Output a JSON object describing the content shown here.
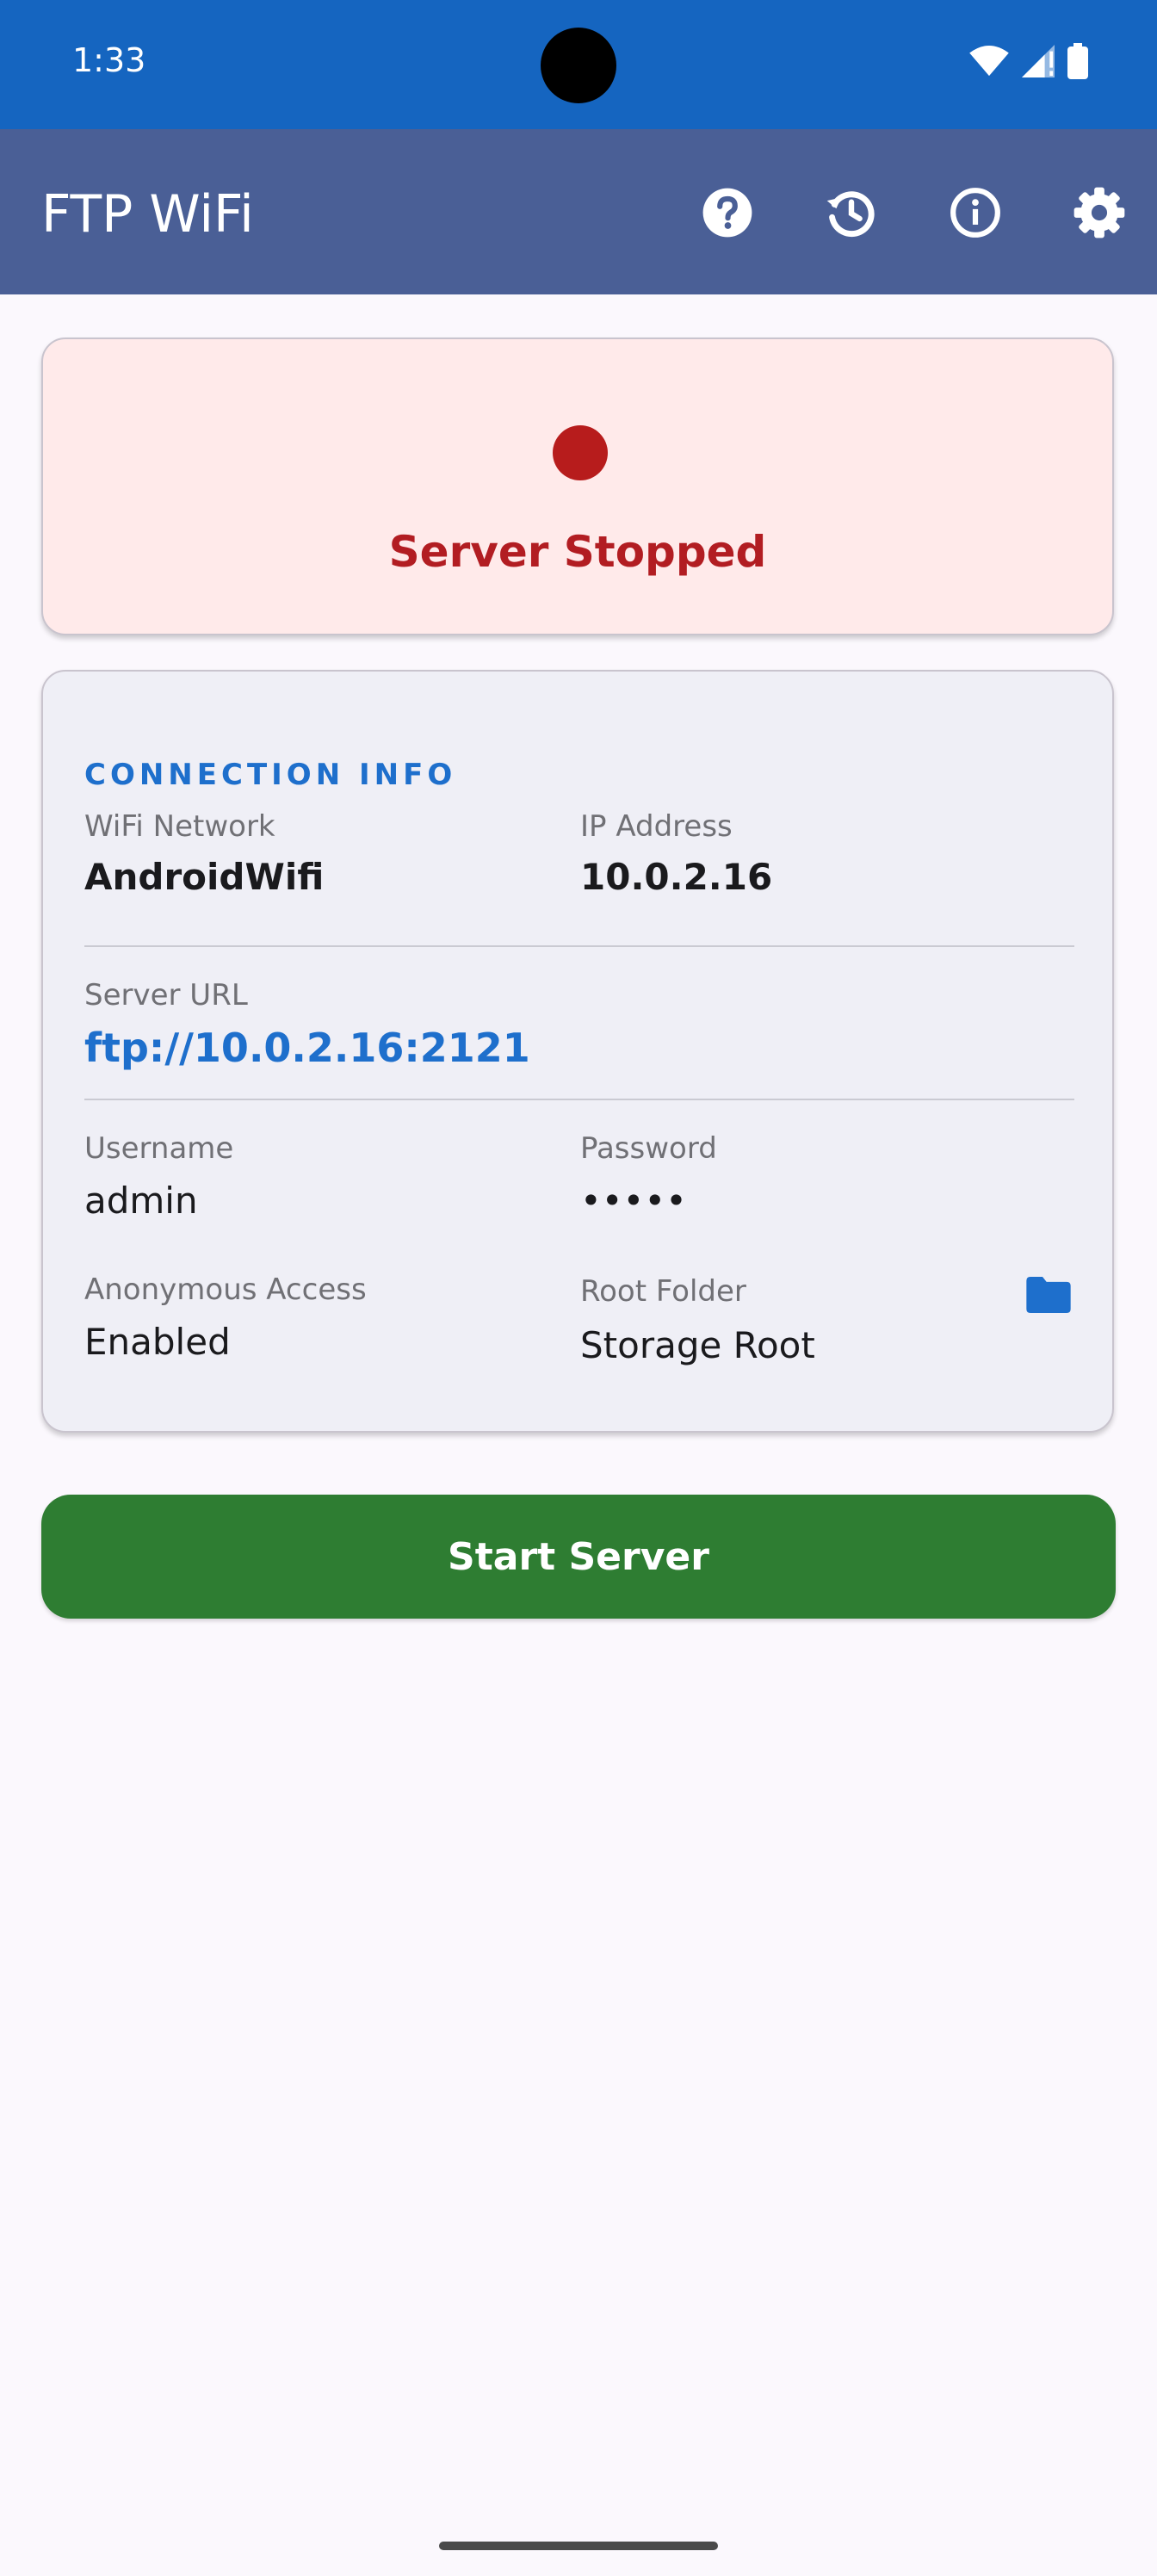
{
  "status_bar": {
    "time": "1:33"
  },
  "app_bar": {
    "title": "FTP WiFi",
    "actions": [
      "help-icon",
      "history-icon",
      "info-icon",
      "settings-icon"
    ]
  },
  "status_card": {
    "text": "Server Stopped",
    "dot_color": "#B71C1C"
  },
  "connection_info": {
    "title": "CONNECTION INFO",
    "wifi_label": "WiFi Network",
    "wifi_value": "AndroidWifi",
    "ip_label": "IP Address",
    "ip_value": "10.0.2.16",
    "url_label": "Server URL",
    "url_value": "ftp://10.0.2.16:2121",
    "username_label": "Username",
    "username_value": "admin",
    "password_label": "Password",
    "password_value": "•••••",
    "anon_label": "Anonymous Access",
    "anon_value": "Enabled",
    "root_label": "Root Folder",
    "root_value": "Storage Root"
  },
  "start_button": {
    "label": "Start Server",
    "color": "#2E7D32"
  },
  "colors": {
    "status_bar": "#1565C0",
    "app_bar": "#4A5F96",
    "accent": "#1E6FCC",
    "stopped": "#B21D22"
  }
}
